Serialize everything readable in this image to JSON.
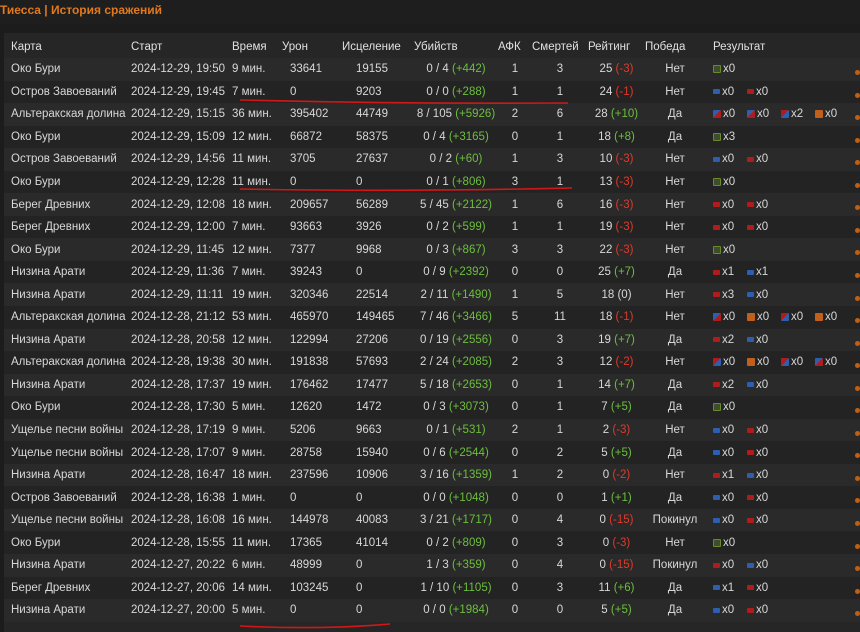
{
  "title": "Тиесса | История сражений",
  "headers": {
    "map": "Карта",
    "start": "Старт",
    "time": "Время",
    "damage": "Урон",
    "heal": "Исцеление",
    "kills": "Убийств",
    "afk": "АФК",
    "deaths": "Смертей",
    "rating": "Рейтинг",
    "win": "Победа",
    "result": "Результат"
  },
  "rows": [
    {
      "map": "Око Бури",
      "start": "2024-12-29, 19:50",
      "time": "9 мин.",
      "damage": "33641",
      "heal": "19155",
      "kills": "0 / 4",
      "kills_delta": "(+442)",
      "afk": "1",
      "deaths": "3",
      "rating": "25",
      "rating_delta": "(-3)",
      "rating_dir": "neg",
      "win": "Нет",
      "tokens": [
        {
          "icon": "flag",
          "count": "x0"
        }
      ]
    },
    {
      "map": "Остров Завоеваний",
      "start": "2024-12-29, 19:45",
      "time": "7 мин.",
      "damage": "0",
      "heal": "9203",
      "kills": "0 / 0",
      "kills_delta": "(+288)",
      "afk": "1",
      "deaths": "1",
      "rating": "24",
      "rating_delta": "(-1)",
      "rating_dir": "neg",
      "win": "Нет",
      "tokens": [
        {
          "icon": "blue",
          "count": "x0"
        },
        {
          "icon": "red",
          "count": "x0"
        }
      ]
    },
    {
      "map": "Альтеракская долина",
      "start": "2024-12-29, 15:15",
      "time": "36 мин.",
      "damage": "395402",
      "heal": "44749",
      "kills": "8 / 105",
      "kills_delta": "(+5926)",
      "afk": "2",
      "deaths": "6",
      "rating": "28",
      "rating_delta": "(+10)",
      "rating_dir": "pos",
      "win": "Да",
      "tokens": [
        {
          "icon": "mix",
          "count": "x0"
        },
        {
          "icon": "mix",
          "count": "x0"
        },
        {
          "icon": "mix2",
          "count": "x2"
        },
        {
          "icon": "or",
          "count": "x0"
        }
      ]
    },
    {
      "map": "Око Бури",
      "start": "2024-12-29, 15:09",
      "time": "12 мин.",
      "damage": "66872",
      "heal": "58375",
      "kills": "0 / 4",
      "kills_delta": "(+3165)",
      "afk": "0",
      "deaths": "1",
      "rating": "18",
      "rating_delta": "(+8)",
      "rating_dir": "pos",
      "win": "Да",
      "tokens": [
        {
          "icon": "flag",
          "count": "x3"
        }
      ]
    },
    {
      "map": "Остров Завоеваний",
      "start": "2024-12-29, 14:56",
      "time": "11 мин.",
      "damage": "3705",
      "heal": "27637",
      "kills": "0 / 2",
      "kills_delta": "(+60)",
      "afk": "1",
      "deaths": "3",
      "rating": "10",
      "rating_delta": "(-3)",
      "rating_dir": "neg",
      "win": "Нет",
      "tokens": [
        {
          "icon": "blue",
          "count": "x0"
        },
        {
          "icon": "red",
          "count": "x0"
        }
      ]
    },
    {
      "map": "Око Бури",
      "start": "2024-12-29, 12:28",
      "time": "11 мин.",
      "damage": "0",
      "heal": "0",
      "kills": "0 / 1",
      "kills_delta": "(+806)",
      "afk": "3",
      "deaths": "1",
      "rating": "13",
      "rating_delta": "(-3)",
      "rating_dir": "neg",
      "win": "Нет",
      "tokens": [
        {
          "icon": "flag",
          "count": "x0"
        }
      ]
    },
    {
      "map": "Берег Древних",
      "start": "2024-12-29, 12:08",
      "time": "18 мин.",
      "damage": "209657",
      "heal": "56289",
      "kills": "5 / 45",
      "kills_delta": "(+2122)",
      "afk": "1",
      "deaths": "6",
      "rating": "16",
      "rating_delta": "(-3)",
      "rating_dir": "neg",
      "win": "Нет",
      "tokens": [
        {
          "icon": "red",
          "count": "x0"
        },
        {
          "icon": "red",
          "count": "x0"
        }
      ]
    },
    {
      "map": "Берег Древних",
      "start": "2024-12-29, 12:00",
      "time": "7 мин.",
      "damage": "93663",
      "heal": "3926",
      "kills": "0 / 2",
      "kills_delta": "(+599)",
      "afk": "1",
      "deaths": "1",
      "rating": "19",
      "rating_delta": "(-3)",
      "rating_dir": "neg",
      "win": "Нет",
      "tokens": [
        {
          "icon": "red",
          "count": "x0"
        },
        {
          "icon": "red",
          "count": "x0"
        }
      ]
    },
    {
      "map": "Око Бури",
      "start": "2024-12-29, 11:45",
      "time": "12 мин.",
      "damage": "7377",
      "heal": "9968",
      "kills": "0 / 3",
      "kills_delta": "(+867)",
      "afk": "3",
      "deaths": "3",
      "rating": "22",
      "rating_delta": "(-3)",
      "rating_dir": "neg",
      "win": "Нет",
      "tokens": [
        {
          "icon": "flag",
          "count": "x0"
        }
      ]
    },
    {
      "map": "Низина Арати",
      "start": "2024-12-29, 11:36",
      "time": "7 мин.",
      "damage": "39243",
      "heal": "0",
      "kills": "0 / 9",
      "kills_delta": "(+2392)",
      "afk": "0",
      "deaths": "0",
      "rating": "25",
      "rating_delta": "(+7)",
      "rating_dir": "pos",
      "win": "Да",
      "tokens": [
        {
          "icon": "red",
          "count": "x1"
        },
        {
          "icon": "blue",
          "count": "x1"
        }
      ]
    },
    {
      "map": "Низина Арати",
      "start": "2024-12-29, 11:11",
      "time": "19 мин.",
      "damage": "320346",
      "heal": "22514",
      "kills": "2 / 11",
      "kills_delta": "(+1490)",
      "afk": "1",
      "deaths": "5",
      "rating": "18",
      "rating_delta": "(0)",
      "rating_dir": "neu",
      "win": "Нет",
      "tokens": [
        {
          "icon": "red",
          "count": "x3"
        },
        {
          "icon": "blue",
          "count": "x0"
        }
      ]
    },
    {
      "map": "Альтеракская долина",
      "start": "2024-12-28, 21:12",
      "time": "53 мин.",
      "damage": "465970",
      "heal": "149465",
      "kills": "7 / 46",
      "kills_delta": "(+3466)",
      "afk": "5",
      "deaths": "11",
      "rating": "18",
      "rating_delta": "(-1)",
      "rating_dir": "neg",
      "win": "Нет",
      "tokens": [
        {
          "icon": "mix",
          "count": "x0"
        },
        {
          "icon": "or",
          "count": "x0"
        },
        {
          "icon": "mix2",
          "count": "x0"
        },
        {
          "icon": "or",
          "count": "x0"
        }
      ]
    },
    {
      "map": "Низина Арати",
      "start": "2024-12-28, 20:58",
      "time": "12 мин.",
      "damage": "122994",
      "heal": "27206",
      "kills": "0 / 19",
      "kills_delta": "(+2556)",
      "afk": "0",
      "deaths": "3",
      "rating": "19",
      "rating_delta": "(+7)",
      "rating_dir": "pos",
      "win": "Да",
      "tokens": [
        {
          "icon": "red",
          "count": "x2"
        },
        {
          "icon": "blue",
          "count": "x0"
        }
      ]
    },
    {
      "map": "Альтеракская долина",
      "start": "2024-12-28, 19:38",
      "time": "30 мин.",
      "damage": "191838",
      "heal": "57693",
      "kills": "2 / 24",
      "kills_delta": "(+2085)",
      "afk": "2",
      "deaths": "3",
      "rating": "12",
      "rating_delta": "(-2)",
      "rating_dir": "neg",
      "win": "Нет",
      "tokens": [
        {
          "icon": "mix2",
          "count": "x0"
        },
        {
          "icon": "or",
          "count": "x0"
        },
        {
          "icon": "mix2",
          "count": "x0"
        },
        {
          "icon": "mix",
          "count": "x0"
        }
      ]
    },
    {
      "map": "Низина Арати",
      "start": "2024-12-28, 17:37",
      "time": "19 мин.",
      "damage": "176462",
      "heal": "17477",
      "kills": "5 / 18",
      "kills_delta": "(+2653)",
      "afk": "0",
      "deaths": "1",
      "rating": "14",
      "rating_delta": "(+7)",
      "rating_dir": "pos",
      "win": "Да",
      "tokens": [
        {
          "icon": "red",
          "count": "x2"
        },
        {
          "icon": "blue",
          "count": "x0"
        }
      ]
    },
    {
      "map": "Око Бури",
      "start": "2024-12-28, 17:30",
      "time": "5 мин.",
      "damage": "12620",
      "heal": "1472",
      "kills": "0 / 3",
      "kills_delta": "(+3073)",
      "afk": "0",
      "deaths": "1",
      "rating": "7",
      "rating_delta": "(+5)",
      "rating_dir": "pos",
      "win": "Да",
      "tokens": [
        {
          "icon": "flag",
          "count": "x0"
        }
      ]
    },
    {
      "map": "Ущелье песни войны",
      "start": "2024-12-28, 17:19",
      "time": "9 мин.",
      "damage": "5206",
      "heal": "9663",
      "kills": "0 / 1",
      "kills_delta": "(+531)",
      "afk": "2",
      "deaths": "1",
      "rating": "2",
      "rating_delta": "(-3)",
      "rating_dir": "neg",
      "win": "Нет",
      "tokens": [
        {
          "icon": "blue",
          "count": "x0"
        },
        {
          "icon": "red",
          "count": "x0"
        }
      ]
    },
    {
      "map": "Ущелье песни войны",
      "start": "2024-12-28, 17:07",
      "time": "9 мин.",
      "damage": "28758",
      "heal": "15940",
      "kills": "0 / 6",
      "kills_delta": "(+2544)",
      "afk": "0",
      "deaths": "2",
      "rating": "5",
      "rating_delta": "(+5)",
      "rating_dir": "pos",
      "win": "Да",
      "tokens": [
        {
          "icon": "blue",
          "count": "x0"
        },
        {
          "icon": "red",
          "count": "x0"
        }
      ]
    },
    {
      "map": "Низина Арати",
      "start": "2024-12-28, 16:47",
      "time": "18 мин.",
      "damage": "237596",
      "heal": "10906",
      "kills": "3 / 16",
      "kills_delta": "(+1359)",
      "afk": "1",
      "deaths": "2",
      "rating": "0",
      "rating_delta": "(-2)",
      "rating_dir": "neg",
      "win": "Нет",
      "tokens": [
        {
          "icon": "red",
          "count": "x1"
        },
        {
          "icon": "blue",
          "count": "x0"
        }
      ]
    },
    {
      "map": "Остров Завоеваний",
      "start": "2024-12-28, 16:38",
      "time": "1 мин.",
      "damage": "0",
      "heal": "0",
      "kills": "0 / 0",
      "kills_delta": "(+1048)",
      "afk": "0",
      "deaths": "0",
      "rating": "1",
      "rating_delta": "(+1)",
      "rating_dir": "pos",
      "win": "Да",
      "tokens": [
        {
          "icon": "blue",
          "count": "x0"
        },
        {
          "icon": "red",
          "count": "x0"
        }
      ]
    },
    {
      "map": "Ущелье песни войны",
      "start": "2024-12-28, 16:08",
      "time": "16 мин.",
      "damage": "144978",
      "heal": "40083",
      "kills": "3 / 21",
      "kills_delta": "(+1717)",
      "afk": "0",
      "deaths": "4",
      "rating": "0",
      "rating_delta": "(-15)",
      "rating_dir": "neg",
      "win": "Покинул",
      "tokens": [
        {
          "icon": "blue",
          "count": "x0"
        },
        {
          "icon": "red",
          "count": "x0"
        }
      ]
    },
    {
      "map": "Око Бури",
      "start": "2024-12-28, 15:55",
      "time": "11 мин.",
      "damage": "17365",
      "heal": "41014",
      "kills": "0 / 2",
      "kills_delta": "(+809)",
      "afk": "0",
      "deaths": "3",
      "rating": "0",
      "rating_delta": "(-3)",
      "rating_dir": "neg",
      "win": "Нет",
      "tokens": [
        {
          "icon": "flag",
          "count": "x0"
        }
      ]
    },
    {
      "map": "Низина Арати",
      "start": "2024-12-27, 20:22",
      "time": "6 мин.",
      "damage": "48999",
      "heal": "0",
      "kills": "1 / 3",
      "kills_delta": "(+359)",
      "afk": "0",
      "deaths": "4",
      "rating": "0",
      "rating_delta": "(-15)",
      "rating_dir": "neg",
      "win": "Покинул",
      "tokens": [
        {
          "icon": "red",
          "count": "x0"
        },
        {
          "icon": "blue",
          "count": "x0"
        }
      ]
    },
    {
      "map": "Берег Древних",
      "start": "2024-12-27, 20:06",
      "time": "14 мин.",
      "damage": "103245",
      "heal": "0",
      "kills": "1 / 10",
      "kills_delta": "(+1105)",
      "afk": "0",
      "deaths": "3",
      "rating": "11",
      "rating_delta": "(+6)",
      "rating_dir": "pos",
      "win": "Да",
      "tokens": [
        {
          "icon": "blue",
          "count": "x1"
        },
        {
          "icon": "red",
          "count": "x0"
        }
      ]
    },
    {
      "map": "Низина Арати",
      "start": "2024-12-27, 20:00",
      "time": "5 мин.",
      "damage": "0",
      "heal": "0",
      "kills": "0 / 0",
      "kills_delta": "(+1984)",
      "afk": "0",
      "deaths": "0",
      "rating": "5",
      "rating_delta": "(+5)",
      "rating_dir": "pos",
      "win": "Да",
      "tokens": [
        {
          "icon": "blue",
          "count": "x0"
        },
        {
          "icon": "red",
          "count": "x0"
        }
      ]
    }
  ],
  "colors": {
    "accent": "#e07a1c",
    "positive": "#6cbf3e",
    "negative": "#e03a2a",
    "annotation": "#d01818"
  }
}
